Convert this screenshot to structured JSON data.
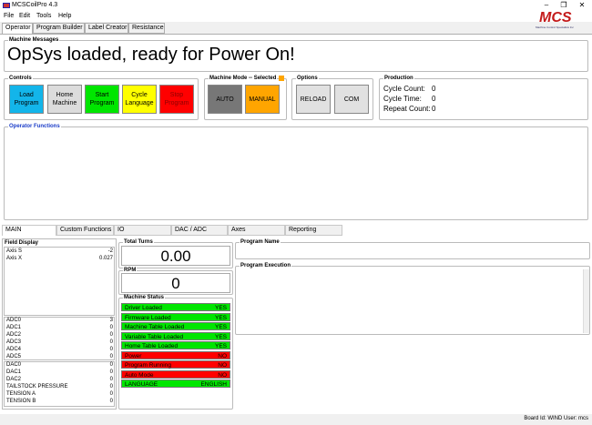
{
  "window": {
    "title": "MCSCoilPro 4.3"
  },
  "logo": {
    "text": "MCS",
    "subtitle": "Machine Control Specialists Inc"
  },
  "menu": [
    "File",
    "Edit",
    "Tools",
    "Help"
  ],
  "tabs": [
    "Operator",
    "Program Builder",
    "Label Creator",
    "Resistance"
  ],
  "machine_messages": {
    "label": "Machine Messages",
    "text": "OpSys loaded, ready for Power On!"
  },
  "controls": {
    "label": "Controls",
    "buttons": [
      {
        "label": "Load Program",
        "color": "#13b5ea"
      },
      {
        "label": "Home Machine",
        "color": "#dcdcdc"
      },
      {
        "label": "Start Program",
        "color": "#00e600"
      },
      {
        "label": "Cycle Language",
        "color": "#ffff00"
      },
      {
        "label": "Stop Program",
        "color": "#ff0000"
      }
    ]
  },
  "machine_mode": {
    "label": "Machine Mode",
    "selected_label": "Selected",
    "buttons": [
      {
        "label": "AUTO",
        "color": "#777777"
      },
      {
        "label": "MANUAL",
        "color": "#ffa500"
      }
    ]
  },
  "options": {
    "label": "Options",
    "buttons": [
      "RELOAD",
      "COM"
    ]
  },
  "production": {
    "label": "Production",
    "rows": [
      {
        "label": "Cycle Count:",
        "value": "0"
      },
      {
        "label": "Cycle Time:",
        "value": "0"
      },
      {
        "label": "Repeat Count:",
        "value": "0"
      }
    ]
  },
  "operator_functions": {
    "label": "Operator Functions"
  },
  "bottom_tabs": [
    "MAIN",
    "Custom Functions",
    "IO",
    "DAC / ADC",
    "Axes",
    "Reporting"
  ],
  "field_display": {
    "label": "Field Display",
    "axes": [
      {
        "name": "Axis S",
        "value": "-2"
      },
      {
        "name": "Axis X",
        "value": "0.027"
      }
    ],
    "adc": [
      {
        "name": "ADC0",
        "value": "3"
      },
      {
        "name": "ADC1",
        "value": "0"
      },
      {
        "name": "ADC2",
        "value": "0"
      },
      {
        "name": "ADC3",
        "value": "0"
      },
      {
        "name": "ADC4",
        "value": "0"
      },
      {
        "name": "ADC5",
        "value": "0"
      }
    ],
    "dac": [
      {
        "name": "DAC0",
        "value": "0"
      },
      {
        "name": "DAC1",
        "value": "0"
      },
      {
        "name": "DAC2",
        "value": "0"
      },
      {
        "name": "TAILSTOCK PRESSURE",
        "value": "0"
      },
      {
        "name": "TENSION A",
        "value": "0"
      },
      {
        "name": "TENSION B",
        "value": "0"
      }
    ]
  },
  "total_turns": {
    "label": "Total Turns",
    "value": "0.00"
  },
  "rpm": {
    "label": "RPM",
    "value": "0"
  },
  "machine_status": {
    "label": "Machine Status",
    "rows": [
      {
        "name": "Driver Loaded",
        "value": "YES",
        "color": "#00e600"
      },
      {
        "name": "Firmware Loaded",
        "value": "YES",
        "color": "#00e600"
      },
      {
        "name": "Machine Table Loaded",
        "value": "YES",
        "color": "#00e600"
      },
      {
        "name": "Variable Table Loaded",
        "value": "YES",
        "color": "#00e600"
      },
      {
        "name": "Home Table Loaded",
        "value": "YES",
        "color": "#00e600"
      },
      {
        "name": "Power",
        "value": "NO",
        "color": "#ff0000"
      },
      {
        "name": "Program Running",
        "value": "NO",
        "color": "#ff0000"
      },
      {
        "name": "Auto Mode",
        "value": "NO",
        "color": "#ff0000"
      },
      {
        "name": "LANGUAGE",
        "value": "ENGLISH",
        "color": "#00e600"
      }
    ]
  },
  "program_name": {
    "label": "Program Name"
  },
  "program_execution": {
    "label": "Program Execution"
  },
  "status": {
    "text": "Board Id: WIND User: mcs"
  }
}
